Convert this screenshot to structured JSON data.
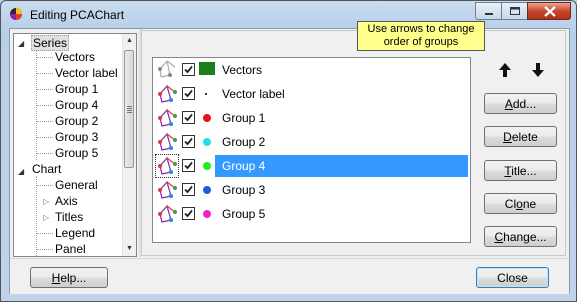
{
  "window": {
    "title": "Editing PCAChart",
    "controls": {
      "minimize_icon": "minimize-icon",
      "maximize_icon": "maximize-icon",
      "close_icon": "close-icon"
    }
  },
  "tree": {
    "items": [
      {
        "label": "Series",
        "level": 0,
        "expanded": true,
        "selected": true
      },
      {
        "label": "Vectors",
        "level": 1
      },
      {
        "label": "Vector label",
        "level": 1
      },
      {
        "label": "Group 1",
        "level": 1
      },
      {
        "label": "Group 4",
        "level": 1
      },
      {
        "label": "Group 2",
        "level": 1
      },
      {
        "label": "Group 3",
        "level": 1
      },
      {
        "label": "Group 5",
        "level": 1
      },
      {
        "label": "Chart",
        "level": 0,
        "expanded": true
      },
      {
        "label": "General",
        "level": 1
      },
      {
        "label": "Axis",
        "level": 1,
        "collapsed": true
      },
      {
        "label": "Titles",
        "level": 1,
        "collapsed": true
      },
      {
        "label": "Legend",
        "level": 1
      },
      {
        "label": "Panel",
        "level": 1
      }
    ]
  },
  "series_list": {
    "rows": [
      {
        "label": "Vectors",
        "checked": true,
        "swatch": "rect",
        "color": "#1a7f1a",
        "selected": false
      },
      {
        "label": "Vector label",
        "checked": true,
        "swatch": "small",
        "color": "#333333",
        "selected": false
      },
      {
        "label": "Group 1",
        "checked": true,
        "swatch": "dot",
        "color": "#e8141b",
        "selected": false
      },
      {
        "label": "Group 2",
        "checked": true,
        "swatch": "dot",
        "color": "#22e0e0",
        "selected": false
      },
      {
        "label": "Group 4",
        "checked": true,
        "swatch": "dot",
        "color": "#22ee22",
        "selected": true
      },
      {
        "label": "Group 3",
        "checked": true,
        "swatch": "dot",
        "color": "#1a5fd6",
        "selected": false
      },
      {
        "label": "Group 5",
        "checked": true,
        "swatch": "dot",
        "color": "#ee22cc",
        "selected": false
      }
    ]
  },
  "tooltip": {
    "line1": "Use arrows to change",
    "line2": "order of groups"
  },
  "order_buttons": {
    "up_icon": "arrow-up-icon",
    "down_icon": "arrow-down-icon"
  },
  "buttons": {
    "add": {
      "label": "Add...",
      "accel": "A",
      "rest": "dd..."
    },
    "delete": {
      "label": "Delete",
      "accel": "D",
      "rest": "elete"
    },
    "title": {
      "label": "Title...",
      "accel": "T",
      "rest": "itle..."
    },
    "clone": {
      "label": "Clone",
      "pre": "Cl",
      "accel": "o",
      "rest": "ne"
    },
    "change": {
      "label": "Change...",
      "accel": "C",
      "rest": "hange..."
    },
    "help": {
      "label": "Help...",
      "accel": "H",
      "rest": "elp..."
    },
    "close": {
      "label": "Close"
    }
  },
  "colors": {
    "selection": "#3399ff",
    "tooltip_bg": "#ffff8c",
    "window_frame": "#b9d1ea"
  }
}
